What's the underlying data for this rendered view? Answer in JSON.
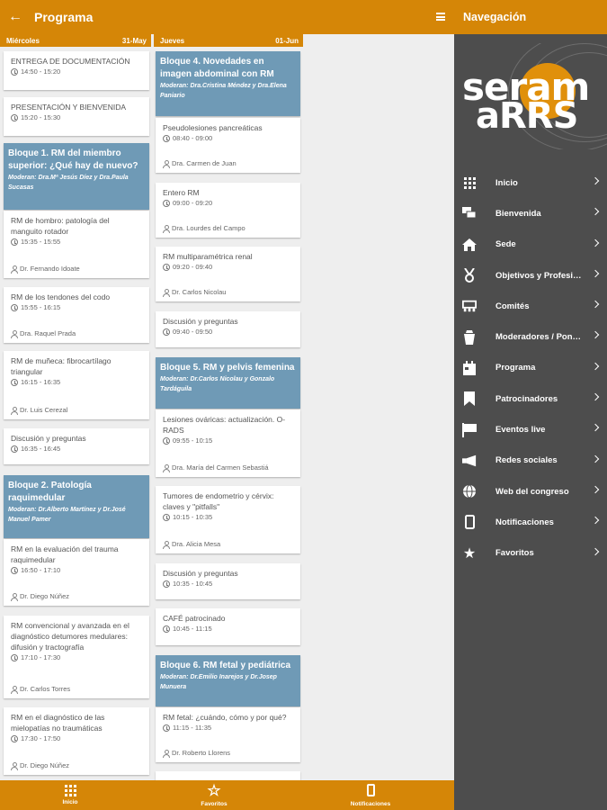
{
  "header": {
    "back_icon": "arrow-left-icon",
    "title": "Programa",
    "menu_icon": "menu-icon"
  },
  "days": [
    {
      "name": "Miércoles",
      "date": "31-May"
    },
    {
      "name": "Jueves",
      "date": "01-Jun"
    }
  ],
  "col1": {
    "items": [
      {
        "title": "ENTREGA DE DOCUMENTACIÓN",
        "time": "14:50 - 15:20"
      },
      {
        "title": "PRESENTACIÓN Y BIENVENIDA",
        "time": "15:20 - 15:30"
      },
      {
        "block_title": "Bloque 1. RM del miembro superior: ¿Qué hay de nuevo?",
        "block_mod": "Moderan: Dra.Mª Jesús Díez y Dra.Paula Sucasas"
      },
      {
        "title": "RM de hombro: patología del manguito rotador",
        "time": "15:35 - 15:55",
        "speaker": "Dr. Fernando Idoate"
      },
      {
        "title": "RM de los tendones del codo",
        "time": "15:55 - 16:15",
        "speaker": "Dra. Raquel Prada"
      },
      {
        "title": "RM de muñeca: fibrocartílago triangular",
        "time": "16:15 - 16:35",
        "speaker": "Dr. Luis Cerezal"
      },
      {
        "title": "Discusión y preguntas",
        "time": "16:35 - 16:45"
      },
      {
        "block_title": "Bloque 2. Patología raquimedular",
        "block_mod": "Moderan: Dr.Alberto Martínez y Dr.José Manuel Pamer"
      },
      {
        "title": "RM en la evaluación del trauma raquimedular",
        "time": "16:50 - 17:10",
        "speaker": "Dr. Diego Núñez"
      },
      {
        "title": "RM convencional y avanzada en el diagnóstico detumores medulares: difusión y tractografía",
        "time": "17:10 - 17:30",
        "speaker": "Dr. Carlos Torres"
      },
      {
        "title": "RM en el diagnóstico de las mielopatías no traumáticas",
        "time": "17:30 - 17:50",
        "speaker": "Dr. Diego Núñez"
      }
    ]
  },
  "col2": {
    "items": [
      {
        "block_title": "Bloque 4. Novedades en imagen abdominal con RM",
        "block_mod": "Moderan: Dra.Cristina Méndez y Dra.Elena Paniario"
      },
      {
        "title": "Pseudolesiones pancreáticas",
        "time": "08:40 - 09:00",
        "speaker": "Dra. Carmen de Juan"
      },
      {
        "title": "Entero RM",
        "time": "09:00 - 09:20",
        "speaker": "Dra. Lourdes del Campo"
      },
      {
        "title": "RM multiparamétrica renal",
        "time": "09:20 - 09:40",
        "speaker": "Dr. Carlos Nicolau"
      },
      {
        "title": "Discusión y preguntas",
        "time": "09:40 - 09:50"
      },
      {
        "block_title": "Bloque 5. RM y pelvis femenina",
        "block_mod": "Moderan: Dr.Carlos Nicolau y Gonzalo Tardáguila"
      },
      {
        "title": "Lesiones ováricas: actualización. O-RADS",
        "time": "09:55 - 10:15",
        "speaker": "Dra. María del Carmen Sebastiá"
      },
      {
        "title": "Tumores de endometrio y cérvix: claves y \"pitfalls\"",
        "time": "10:15 - 10:35",
        "speaker": "Dra. Alicia Mesa"
      },
      {
        "title": "Discusión y preguntas",
        "time": "10:35 - 10:45"
      },
      {
        "title": "CAFÉ patrocinado",
        "time": "10:45 - 11:15"
      },
      {
        "block_title": "Bloque 6. RM fetal y pediátrica",
        "block_mod": "Moderan: Dr.Emilio Inarejos y Dr.Josep Munuera"
      },
      {
        "title": "RM fetal: ¿cuándo, cómo y por qué?",
        "time": "11:15 - 11:35",
        "speaker": "Dr. Roberto Llorens"
      }
    ]
  },
  "bottom_nav": [
    {
      "label": "Inicio",
      "icon": "grid-icon"
    },
    {
      "label": "Favoritos",
      "icon": "star-icon"
    },
    {
      "label": "Notificaciones",
      "icon": "phone-icon"
    }
  ],
  "drawer": {
    "title": "Navegación",
    "logo_line1": "seram",
    "logo_line2": "aRRS",
    "items": [
      {
        "label": "Inicio",
        "icon": "grid-icon"
      },
      {
        "label": "Bienvenida",
        "icon": "chat-icon"
      },
      {
        "label": "Sede",
        "icon": "home-icon"
      },
      {
        "label": "Objetivos y Profesi…",
        "icon": "medal-icon"
      },
      {
        "label": "Comités",
        "icon": "committee-icon"
      },
      {
        "label": "Moderadores / Pon…",
        "icon": "bucket-icon"
      },
      {
        "label": "Programa",
        "icon": "calendar-icon"
      },
      {
        "label": "Patrocinadores",
        "icon": "bookmark-icon"
      },
      {
        "label": "Eventos live",
        "icon": "flag-icon"
      },
      {
        "label": "Redes sociales",
        "icon": "megaphone-icon"
      },
      {
        "label": "Web del congreso",
        "icon": "globe-icon"
      },
      {
        "label": "Notificaciones",
        "icon": "phone-icon"
      },
      {
        "label": "Favoritos",
        "icon": "star-half-icon"
      }
    ]
  },
  "colors": {
    "accent": "#d58607",
    "block": "#6f9ab6",
    "drawer_bg": "#4d4d4d"
  }
}
